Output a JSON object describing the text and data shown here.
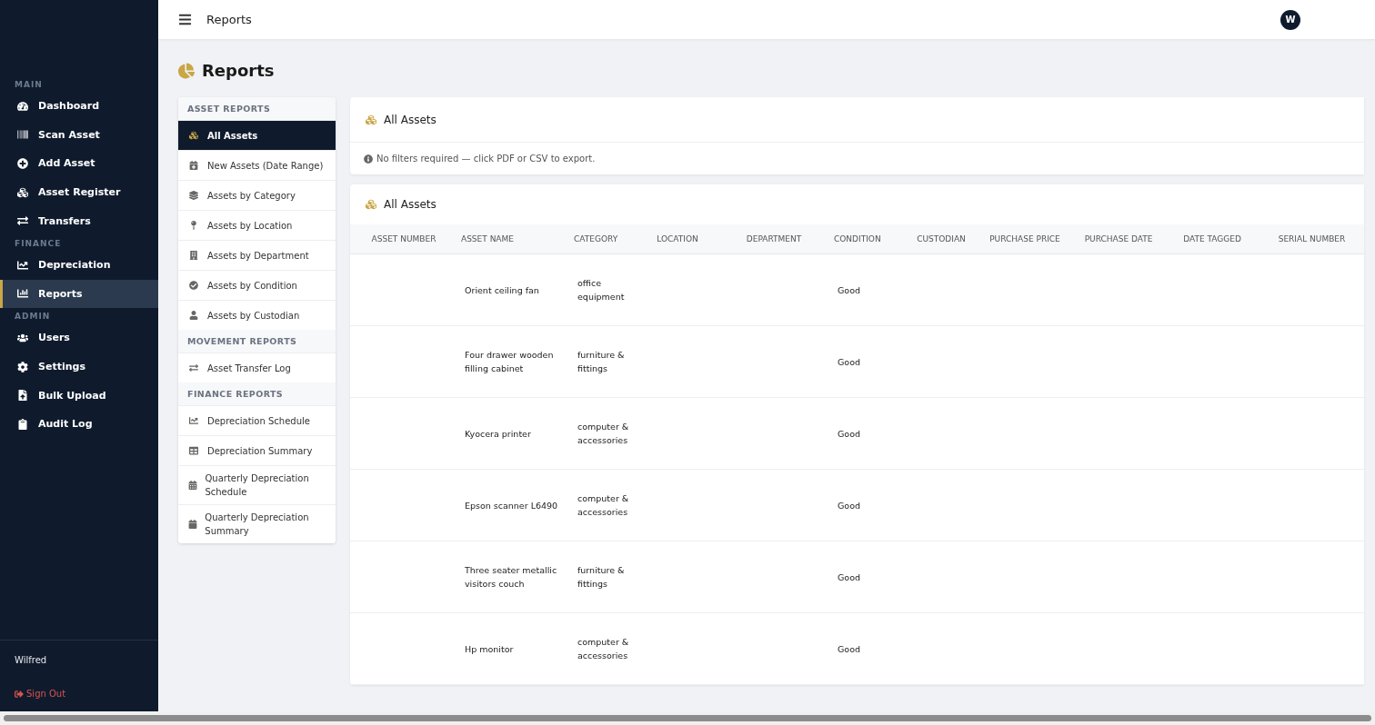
{
  "topbar": {
    "title": "Reports",
    "avatar": "W"
  },
  "sidebar": {
    "sections": [
      {
        "label": "MAIN",
        "items": [
          {
            "label": "Dashboard",
            "selected": false
          },
          {
            "label": "Scan Asset",
            "selected": false
          },
          {
            "label": "Add Asset",
            "selected": false
          },
          {
            "label": "Asset Register",
            "selected": false
          },
          {
            "label": "Transfers",
            "selected": false
          }
        ]
      },
      {
        "label": "FINANCE",
        "items": [
          {
            "label": "Depreciation",
            "selected": false
          },
          {
            "label": "Reports",
            "selected": true
          }
        ]
      },
      {
        "label": "ADMIN",
        "items": [
          {
            "label": "Users",
            "selected": false
          },
          {
            "label": "Settings",
            "selected": false
          },
          {
            "label": "Bulk Upload",
            "selected": false
          },
          {
            "label": "Audit Log",
            "selected": false
          }
        ]
      }
    ],
    "user": "Wilfred",
    "sign_out": "Sign Out"
  },
  "page_title": "Reports",
  "report_menu": [
    {
      "label": "ASSET REPORTS",
      "items": [
        {
          "label": "All Assets",
          "selected": true
        },
        {
          "label": "New Assets (Date Range)",
          "selected": false
        },
        {
          "label": "Assets by Category",
          "selected": false
        },
        {
          "label": "Assets by Location",
          "selected": false
        },
        {
          "label": "Assets by Department",
          "selected": false
        },
        {
          "label": "Assets by Condition",
          "selected": false
        },
        {
          "label": "Assets by Custodian",
          "selected": false
        }
      ]
    },
    {
      "label": "MOVEMENT REPORTS",
      "items": [
        {
          "label": "Asset Transfer Log",
          "selected": false
        }
      ]
    },
    {
      "label": "FINANCE REPORTS",
      "items": [
        {
          "label": "Depreciation Schedule",
          "selected": false
        },
        {
          "label": "Depreciation Summary",
          "selected": false
        },
        {
          "label": "Quarterly Depreciation Schedule",
          "selected": false
        },
        {
          "label": "Quarterly Depreciation Summary",
          "selected": false
        }
      ]
    }
  ],
  "filter_card": {
    "title": "All Assets",
    "hint": "No filters required — click PDF or CSV to export."
  },
  "table": {
    "title": "All Assets",
    "columns": [
      "ASSET NUMBER",
      "ASSET NAME",
      "CATEGORY",
      "LOCATION",
      "DEPARTMENT",
      "CONDITION",
      "CUSTODIAN",
      "PURCHASE PRICE",
      "PURCHASE DATE",
      "DATE TAGGED",
      "SERIAL NUMBER"
    ],
    "rows": [
      {
        "asset_name": "Orient ceiling fan",
        "category": "office equipment",
        "condition": "Good"
      },
      {
        "asset_name": "Four drawer wooden filling cabinet",
        "category": "furniture & fittings",
        "condition": "Good"
      },
      {
        "asset_name": "Kyocera printer",
        "category": "computer & accessories",
        "condition": "Good"
      },
      {
        "asset_name": "Epson scanner L6490",
        "category": "computer & accessories",
        "condition": "Good"
      },
      {
        "asset_name": "Three seater metallic visitors couch",
        "category": "furniture & fittings",
        "condition": "Good"
      },
      {
        "asset_name": "Hp monitor",
        "category": "computer & accessories",
        "condition": "Good"
      }
    ]
  }
}
